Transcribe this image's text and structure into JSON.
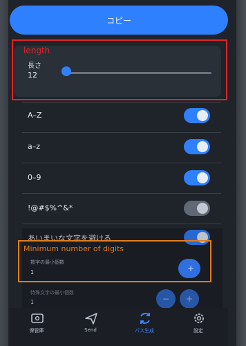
{
  "copy_button": {
    "label": "コピー"
  },
  "length": {
    "annotation": "length",
    "label": "長さ",
    "value": "12",
    "slider_fraction": 0.03
  },
  "options": [
    {
      "label": "A–Z",
      "checked": true
    },
    {
      "label": "a–z",
      "checked": true
    },
    {
      "label": "0–9",
      "checked": true
    },
    {
      "label": "!@#$%^&*",
      "checked": false
    },
    {
      "label": "あいまいな文字を避ける",
      "checked": true
    }
  ],
  "min_digits": {
    "annotation": "Minimum number of digits",
    "label": "数字の最小個数",
    "value": "1",
    "minus": "−",
    "plus": "+"
  },
  "min_special": {
    "label": "特殊文字の最小個数",
    "value": "1",
    "minus": "−",
    "plus": "+"
  },
  "nav": [
    {
      "label": "保管庫",
      "icon": "vault-icon",
      "active": false
    },
    {
      "label": "Send",
      "icon": "send-icon",
      "active": false
    },
    {
      "label": "パス生成",
      "icon": "generator-icon",
      "active": true
    },
    {
      "label": "設定",
      "icon": "gear-icon",
      "active": false
    }
  ],
  "colors": {
    "accent": "#2f80ff",
    "annotation_red": "#e0242a",
    "annotation_orange": "#e37d1c"
  }
}
